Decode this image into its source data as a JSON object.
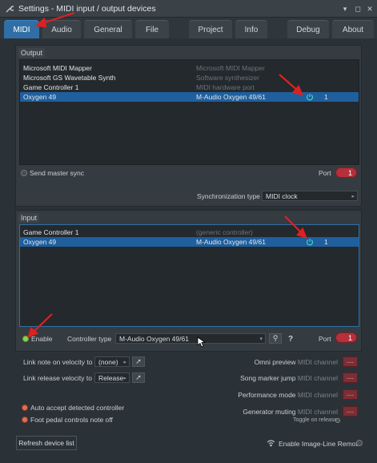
{
  "window": {
    "title": "Settings - MIDI input / output devices"
  },
  "tabs": [
    {
      "label": "MIDI"
    },
    {
      "label": "Audio"
    },
    {
      "label": "General"
    },
    {
      "label": "File"
    },
    {
      "label": "Project"
    },
    {
      "label": "Info"
    },
    {
      "label": "Debug"
    },
    {
      "label": "About"
    }
  ],
  "output": {
    "label": "Output",
    "devices": [
      {
        "name": "Microsoft MIDI Mapper",
        "desc": "Microsoft MIDI Mapper",
        "port": ""
      },
      {
        "name": "Microsoft GS Wavetable Synth",
        "desc": "Software synthesizer",
        "port": ""
      },
      {
        "name": "Game Controller 1",
        "desc": "MIDI hardware port",
        "port": ""
      },
      {
        "name": "Oxygen 49",
        "desc": "M-Audio Oxygen 49/61",
        "port": "1"
      }
    ],
    "send_master_sync": "Send master sync",
    "port_label": "Port",
    "port_value": "1",
    "sync_type_label": "Synchronization type",
    "sync_type_value": "MIDI clock"
  },
  "input": {
    "label": "Input",
    "devices": [
      {
        "name": "Game Controller 1",
        "desc": "(generic controller)",
        "port": ""
      },
      {
        "name": "Oxygen 49",
        "desc": "M-Audio Oxygen 49/61",
        "port": "1"
      }
    ],
    "enable_label": "Enable",
    "controller_type_label": "Controller type",
    "controller_type_value": "M-Audio Oxygen 49/61",
    "port_label": "Port",
    "port_value": "1",
    "help_symbol": "?"
  },
  "options": {
    "link_note_velocity_label": "Link note on velocity to",
    "link_note_velocity_value": "(none)",
    "link_release_velocity_label": "Link release velocity to",
    "link_release_velocity_value": "Release",
    "auto_accept_label": "Auto accept detected controller",
    "foot_pedal_label": "Foot pedal controls note off",
    "omni_preview_label": "Omni preview",
    "song_marker_jump_label": "Song marker jump",
    "performance_mode_label": "Performance mode",
    "generator_muting_label": "Generator muting",
    "midi_channel_label": "MIDI channel",
    "toggle_on_release_label": "Toggle on release",
    "channel_value": "---"
  },
  "footer": {
    "refresh_label": "Refresh device list",
    "remote_label": "Enable Image-Line Remote"
  },
  "colors": {
    "accent": "#2f6fa5",
    "selected_row": "#1f5f9e",
    "port_red": "#b5303a",
    "power_icon": "#3fd3c3",
    "annotation_arrow": "#e02020"
  }
}
